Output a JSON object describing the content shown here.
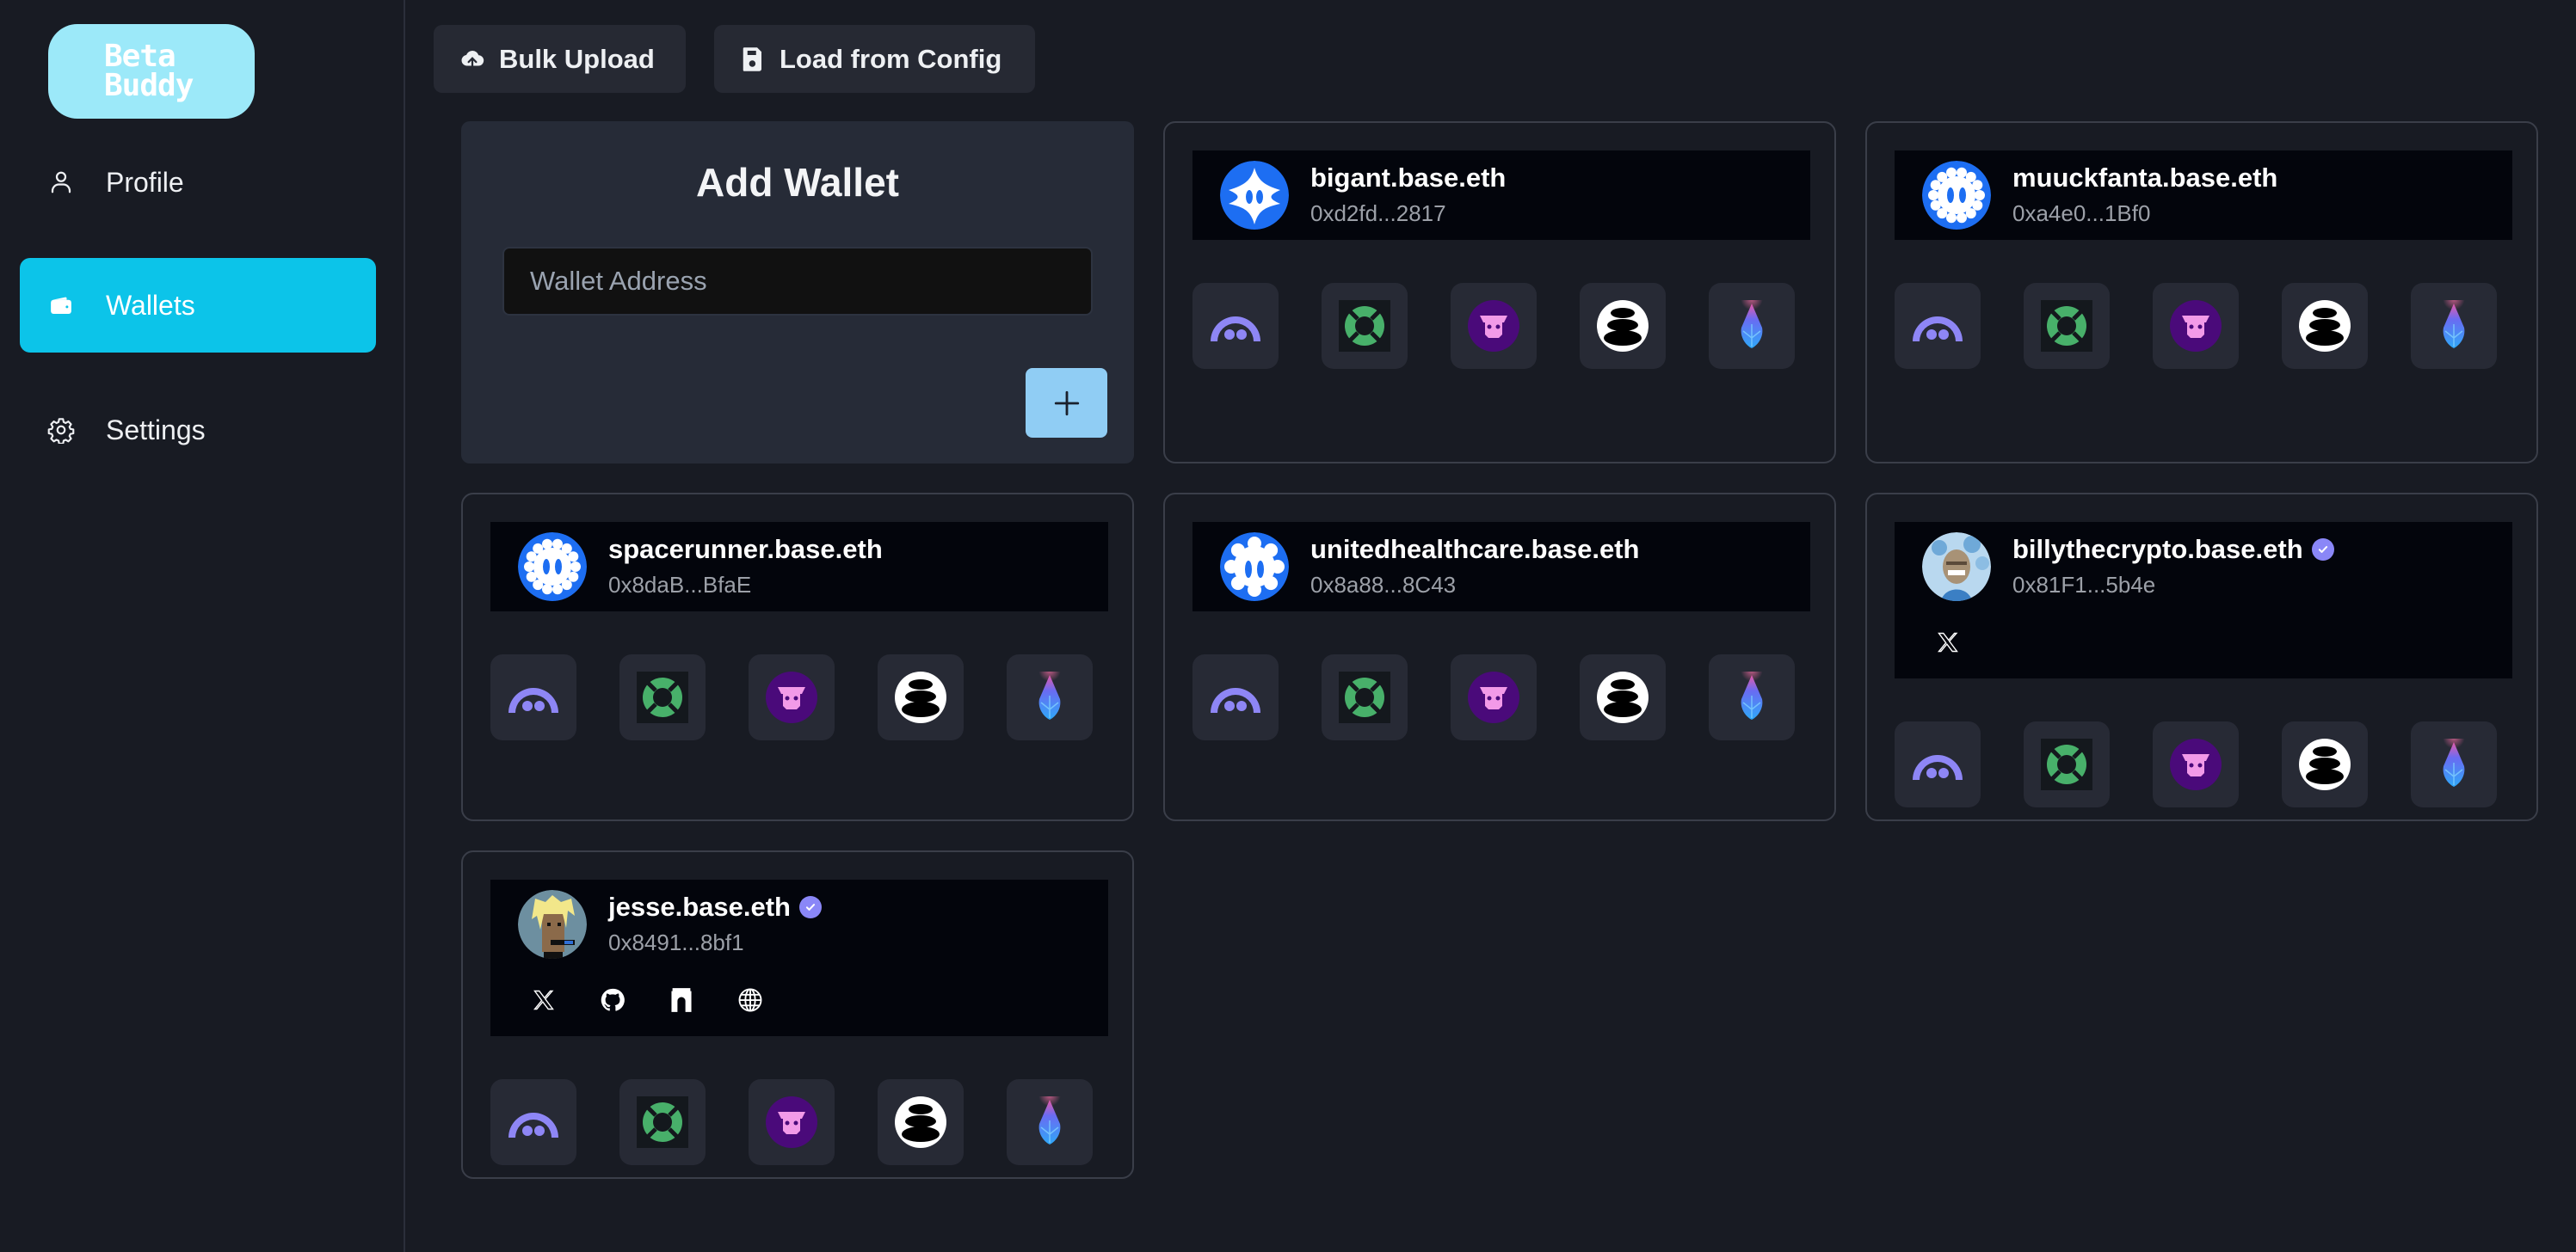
{
  "app": {
    "logo_line1": "Beta",
    "logo_line2": "Buddy"
  },
  "sidebar": {
    "items": [
      {
        "label": "Profile",
        "icon": "user-icon",
        "active": false
      },
      {
        "label": "Wallets",
        "icon": "wallet-icon",
        "active": true
      },
      {
        "label": "Settings",
        "icon": "gear-icon",
        "active": false
      }
    ]
  },
  "toolbar": {
    "bulk_upload_label": "Bulk Upload",
    "bulk_upload_icon": "cloud-upload-icon",
    "load_config_label": "Load from Config",
    "load_config_icon": "floppy-disk-icon"
  },
  "add_wallet": {
    "title": "Add Wallet",
    "input_value": "",
    "input_placeholder": "Wallet Address",
    "add_button_icon": "plus-icon"
  },
  "colors": {
    "accent": "#0cc4e9",
    "logo_bg": "#9ce9f9",
    "add_button": "#90cdf4",
    "verified": "#8a87f7",
    "background": "#181b23"
  },
  "app_tiles": [
    {
      "name": "purple-dome-app",
      "icon": "dome-icon",
      "color": "#8e86f5"
    },
    {
      "name": "green-lifebuoy-app",
      "icon": "lifebuoy-icon",
      "color": "#48b06a"
    },
    {
      "name": "pink-cow-app",
      "icon": "cow-icon",
      "color": "#f29ae8"
    },
    {
      "name": "stacked-stones-app",
      "icon": "stones-icon",
      "color": "#ffffff"
    },
    {
      "name": "blue-flame-app",
      "icon": "flame-icon",
      "color": "#3d8cf2"
    }
  ],
  "wallets": [
    {
      "name": "bigant.base.eth",
      "address": "0xd2fd...2817",
      "verified": false,
      "avatar": "blue-cross-avatar",
      "socials": []
    },
    {
      "name": "muuckfanta.base.eth",
      "address": "0xa4e0...1Bf0",
      "verified": false,
      "avatar": "blue-flower-avatar",
      "socials": []
    },
    {
      "name": "spacerunner.base.eth",
      "address": "0x8daB...BfaE",
      "verified": false,
      "avatar": "blue-flower-avatar",
      "socials": []
    },
    {
      "name": "unitedhealthcare.base.eth",
      "address": "0x8a88...8C43",
      "verified": false,
      "avatar": "blue-gear-avatar",
      "socials": []
    },
    {
      "name": "billythecrypto.base.eth",
      "address": "0x81F1...5b4e",
      "verified": true,
      "avatar": "ape-avatar",
      "socials": [
        "x-icon"
      ]
    },
    {
      "name": "jesse.base.eth",
      "address": "0x8491...8bf1",
      "verified": true,
      "avatar": "punk-avatar",
      "socials": [
        "x-icon",
        "github-icon",
        "farcaster-icon",
        "globe-icon"
      ]
    }
  ]
}
